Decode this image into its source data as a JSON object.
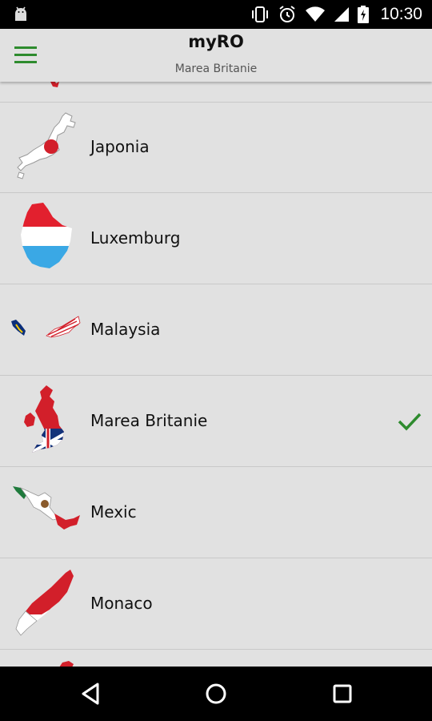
{
  "status_bar": {
    "time": "10:30",
    "icons": [
      "android-icon",
      "vibrate-icon",
      "alarm-icon",
      "wifi-icon",
      "signal-icon",
      "battery-icon"
    ]
  },
  "app": {
    "title": "myRO",
    "subtitle": "Marea Britanie"
  },
  "countries": [
    {
      "name": "Japonia",
      "selected": false,
      "flag": "japan-map-flag-icon"
    },
    {
      "name": "Luxemburg",
      "selected": false,
      "flag": "luxembourg-map-flag-icon"
    },
    {
      "name": "Malaysia",
      "selected": false,
      "flag": "malaysia-map-flag-icon"
    },
    {
      "name": "Marea Britanie",
      "selected": true,
      "flag": "uk-map-flag-icon"
    },
    {
      "name": "Mexic",
      "selected": false,
      "flag": "mexico-map-flag-icon"
    },
    {
      "name": "Monaco",
      "selected": false,
      "flag": "monaco-map-flag-icon"
    }
  ],
  "colors": {
    "accent": "#2e8b2e",
    "background": "#e1e1e1",
    "divider": "#c8c8c8"
  },
  "nav_bar": [
    "back-icon",
    "home-icon",
    "recents-icon"
  ]
}
